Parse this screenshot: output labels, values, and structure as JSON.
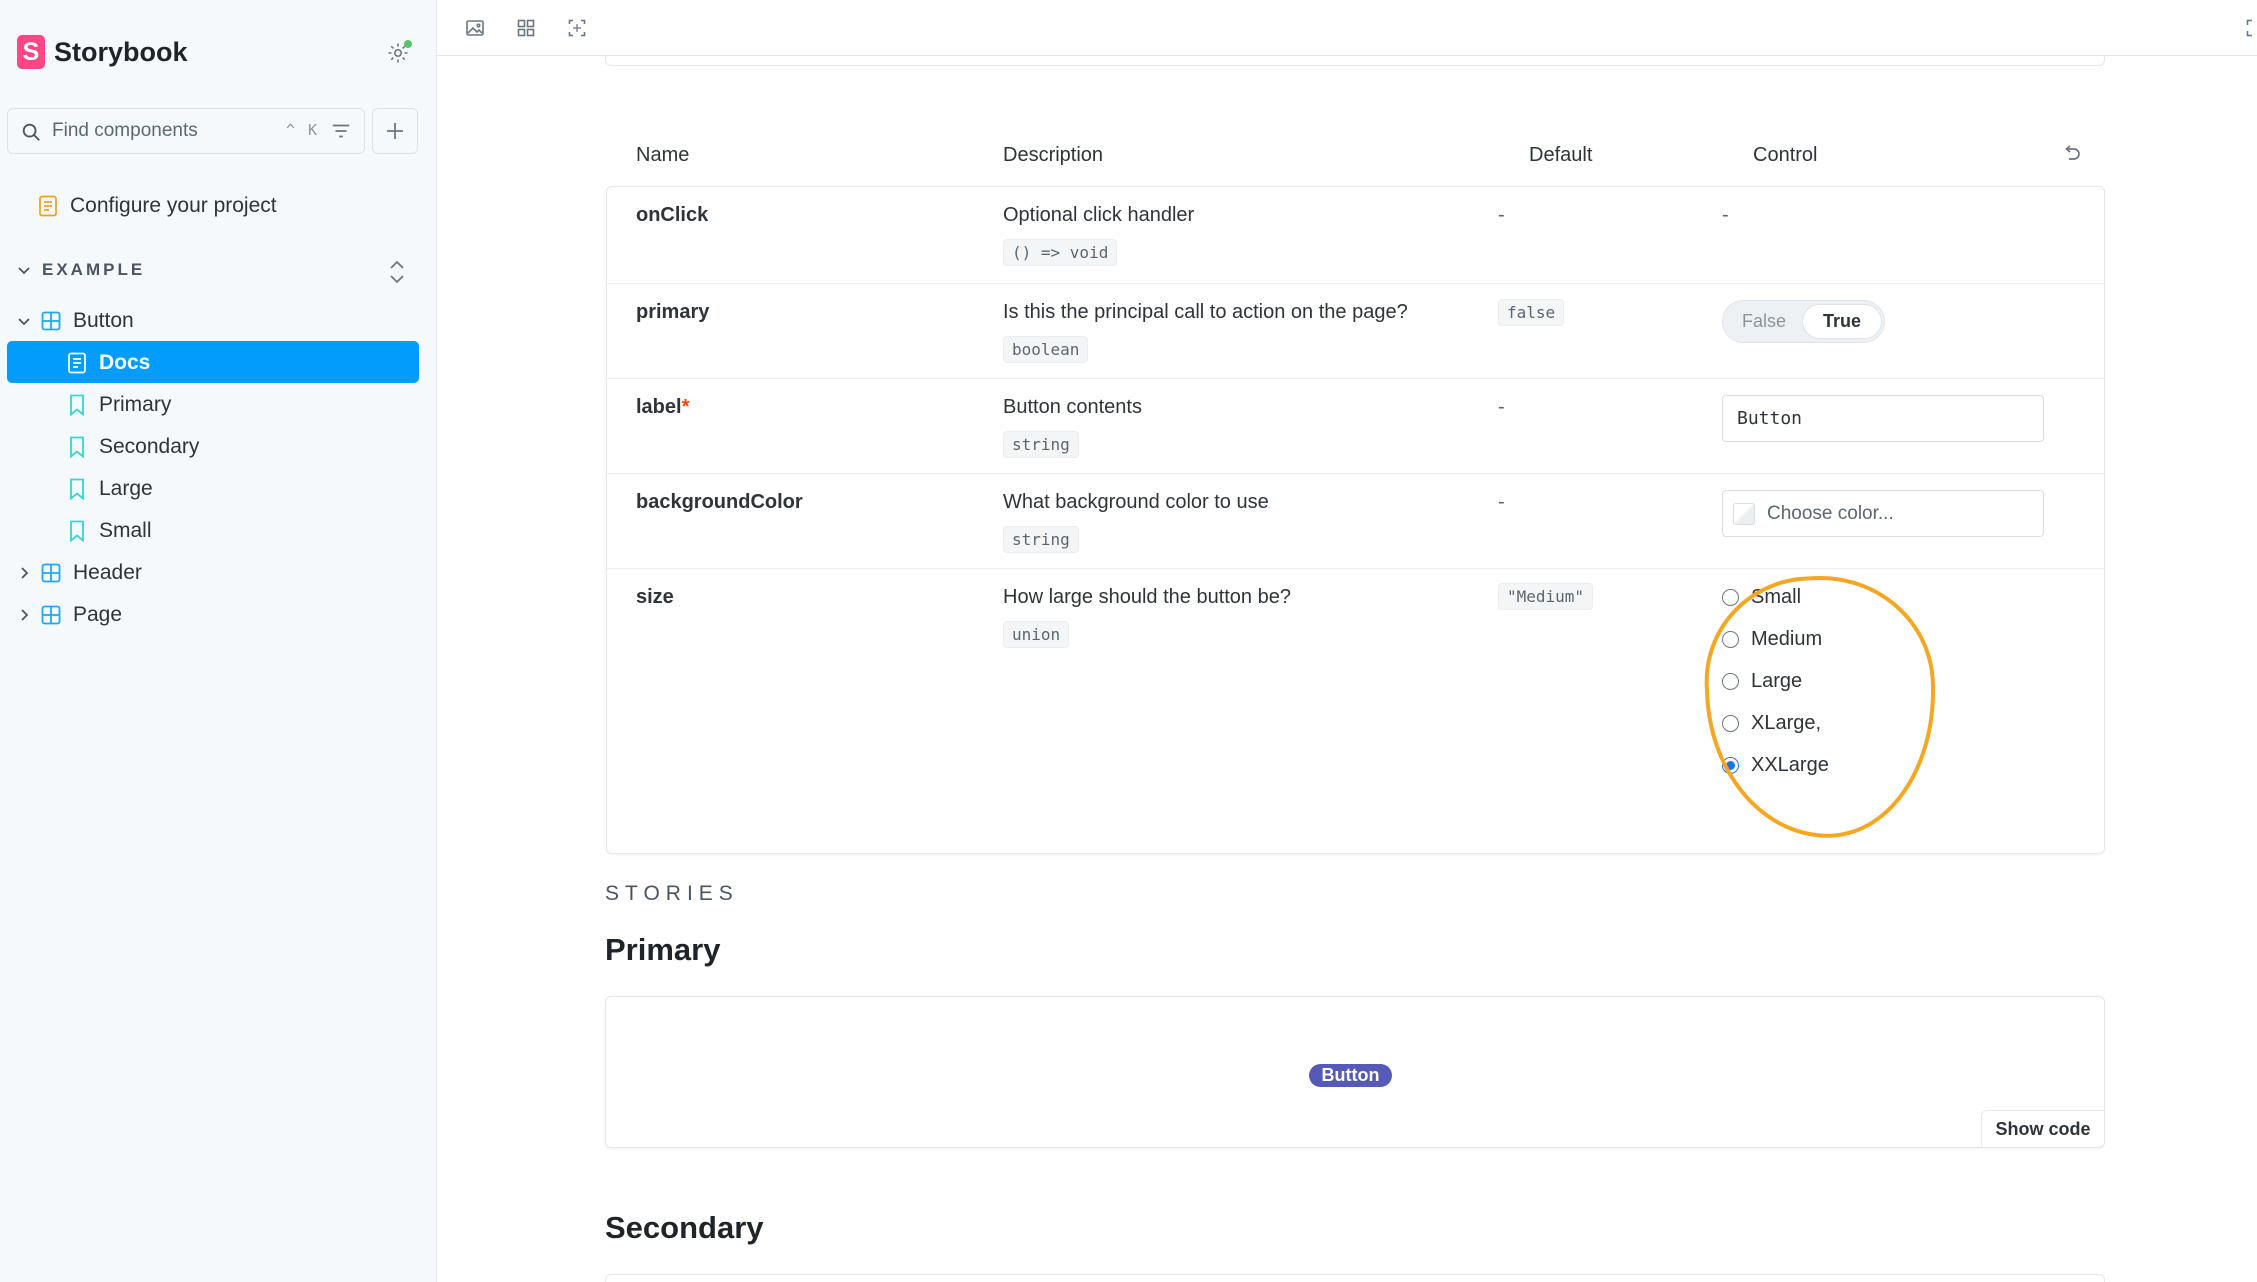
{
  "sidebar": {
    "brand": {
      "logo_letter": "S",
      "name": "Storybook"
    },
    "search": {
      "placeholder": "Find components",
      "shortcut": "^ K"
    },
    "configure": {
      "label": "Configure your project"
    },
    "section": {
      "label": "EXAMPLE"
    },
    "tree": {
      "button": "Button",
      "docs": "Docs",
      "primary": "Primary",
      "secondary": "Secondary",
      "large": "Large",
      "small": "Small",
      "header": "Header",
      "page": "Page"
    }
  },
  "argtable": {
    "headers": {
      "name": "Name",
      "description": "Description",
      "default": "Default",
      "control": "Control"
    },
    "rows": {
      "onClick": {
        "name": "onClick",
        "description": "Optional click handler",
        "type": "() => void",
        "default": "-",
        "control": "-"
      },
      "primary": {
        "name": "primary",
        "description": "Is this the principal call to action on the page?",
        "type": "boolean",
        "default": "false",
        "false_label": "False",
        "true_label": "True",
        "selected": "True"
      },
      "label": {
        "name": "label",
        "required_mark": "*",
        "description": "Button contents",
        "type": "string",
        "default": "-",
        "value": "Button"
      },
      "backgroundColor": {
        "name": "backgroundColor",
        "description": "What background color to use",
        "type": "string",
        "default": "-",
        "placeholder": "Choose color..."
      },
      "size": {
        "name": "size",
        "description": "How large should the button be?",
        "type": "union",
        "default": "\"Medium\"",
        "options": [
          "Small",
          "Medium",
          "Large",
          "XLarge,",
          "XXLarge"
        ],
        "selected": "XXLarge"
      }
    }
  },
  "stories": {
    "label": "STORIES",
    "primary_title": "Primary",
    "demo_button": "Button",
    "show_code": "Show code",
    "secondary_title": "Secondary"
  },
  "colors": {
    "accent": "#029cfd",
    "brand": "#ff4785",
    "demo_button": "#555ab9",
    "highlight": "#f5a623"
  }
}
